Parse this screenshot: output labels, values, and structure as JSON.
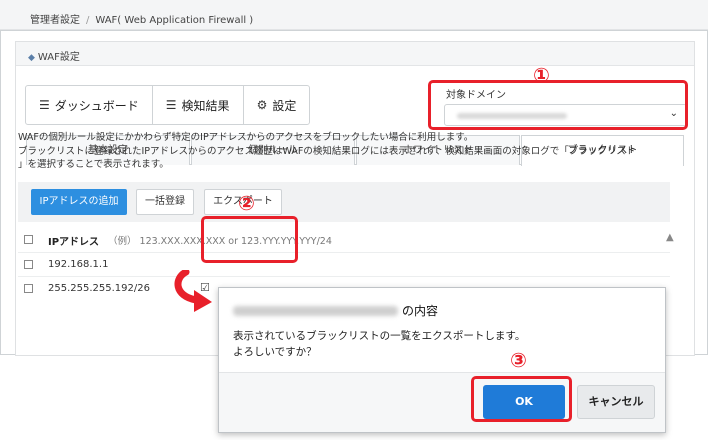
{
  "breadcrumb": {
    "root": "管理者設定",
    "separator": "/",
    "current": "WAF( Web Application Firewall )"
  },
  "panel": {
    "title": "WAF設定",
    "icon": "shield-icon"
  },
  "nav_buttons": [
    {
      "label": "ダッシュボード",
      "icon": "list-icon"
    },
    {
      "label": "検知結果",
      "icon": "list-icon"
    },
    {
      "label": "設定",
      "icon": "gear-icon"
    }
  ],
  "domain": {
    "label": "対象ドメイン",
    "chevron": "⌄"
  },
  "tabs": [
    {
      "label": "基本設定"
    },
    {
      "label": "個別ルール"
    },
    {
      "label": "ホワイトリスト"
    },
    {
      "label": "ブラックリスト",
      "active": true
    }
  ],
  "description": [
    "WAFの個別ルール設定にかかわらず特定のIPアドレスからのアクセスをブロックしたい場合に利用します。",
    "ブラックリストに登録されたIPアドレスからのアクセス履歴はWAFの検知結果ログには表示されず、検知結果画面の対象ログで「ブラックリスト",
    "」を選択することで表示されます。"
  ],
  "toolbar": {
    "add_label": "IPアドレスの追加",
    "bulk_label": "一括登録",
    "export_label": "エクスポート"
  },
  "table": {
    "header": "IPアドレス",
    "example": "（例） 123.XXX.XXX.XXX or 123.YYY.YYY.YYY/24",
    "rows": [
      {
        "ip": "192.168.1.1"
      },
      {
        "ip": "255.255.255.192/26"
      }
    ]
  },
  "dialog": {
    "title_suffix": "の内容",
    "line1": "表示されているブラックリストの一覧をエクスポートします。",
    "line2": "よろしいですか？",
    "ok_label": "OK",
    "cancel_label": "キャンセル"
  },
  "markers": {
    "one": "①",
    "two": "②",
    "three": "③"
  },
  "colors": {
    "primary": "#2d8fe0",
    "highlight": "#e8202a"
  }
}
